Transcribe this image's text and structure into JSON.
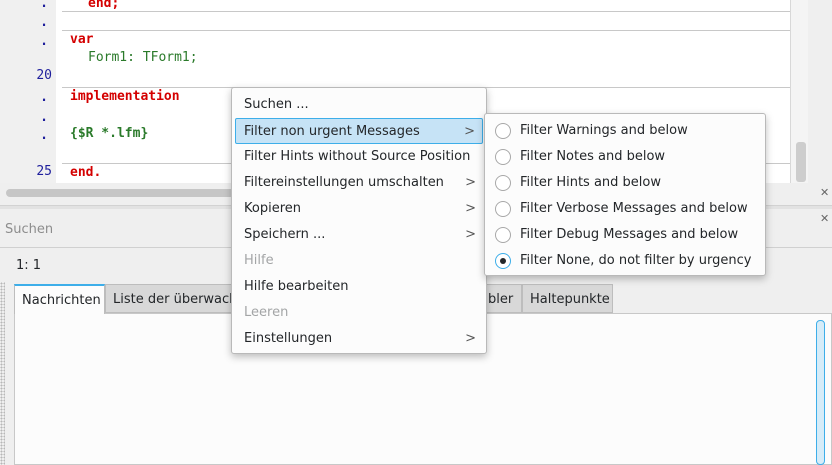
{
  "editor": {
    "gutter": [
      ".",
      ".",
      ".",
      "20",
      ".",
      ".",
      ".",
      "25"
    ],
    "code": {
      "line_end1": "end;",
      "line_var": "var",
      "line_form_id": "Form1",
      "line_form_rest": ": TForm1;",
      "line_impl": "implementation",
      "line_dir": "{$R *.lfm}",
      "line_end2": "end."
    }
  },
  "search": {
    "placeholder": "Suchen"
  },
  "status": {
    "cursor_pos": "1:  1"
  },
  "tabs": [
    {
      "label": "Nachrichten"
    },
    {
      "label": "Liste der überwacht"
    },
    {
      "label": "bler"
    },
    {
      "label": "Haltepunkte"
    }
  ],
  "context_menu": {
    "items": [
      {
        "label": "Suchen ..."
      },
      {
        "label": "Filter non urgent Messages",
        "arrow": ">"
      },
      {
        "label": "Filter Hints without Source Position"
      },
      {
        "label": "Filtereinstellungen umschalten",
        "arrow": ">"
      },
      {
        "label": "Kopieren",
        "arrow": ">"
      },
      {
        "label": "Speichern ...",
        "arrow": ">"
      },
      {
        "label": "Hilfe"
      },
      {
        "label": "Hilfe bearbeiten"
      },
      {
        "label": "Leeren"
      },
      {
        "label": "Einstellungen",
        "arrow": ">"
      }
    ]
  },
  "submenu": {
    "items": [
      {
        "label": "Filter Warnings and below"
      },
      {
        "label": "Filter Notes and below"
      },
      {
        "label": "Filter Hints and below"
      },
      {
        "label": "Filter Verbose Messages and below"
      },
      {
        "label": "Filter Debug Messages and below"
      },
      {
        "label": "Filter None, do not filter by urgency"
      }
    ]
  },
  "colors": {
    "accent": "#3daee9",
    "highlight": "#c6e3f6",
    "keyword": "#d40000",
    "identifier": "#2a7a2a",
    "gutter_text": "#1e1e9c"
  }
}
